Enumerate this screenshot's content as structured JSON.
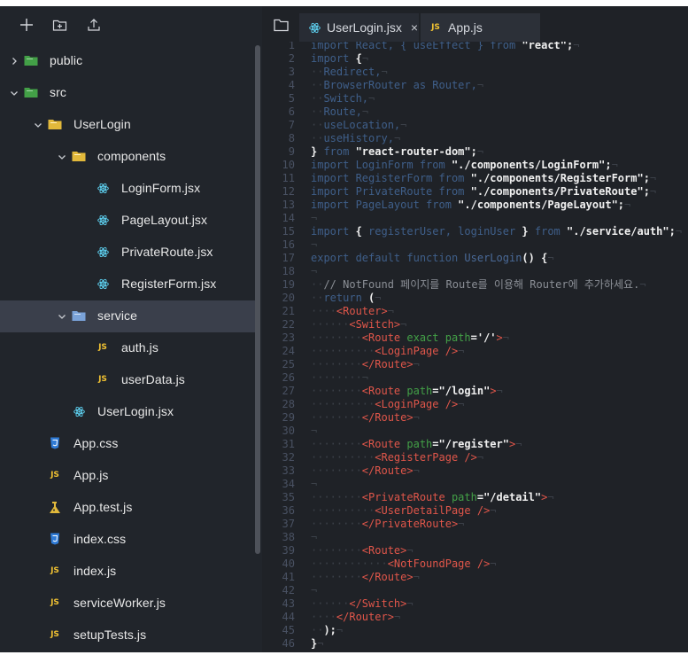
{
  "toolbar": {
    "new_file_icon": "plus-icon",
    "new_folder_icon": "new-folder-icon",
    "upload_icon": "upload-icon"
  },
  "tree": {
    "items": [
      {
        "label": "public",
        "level": 0,
        "chevron": "right",
        "icon": "folder-green"
      },
      {
        "label": "src",
        "level": 0,
        "chevron": "down",
        "icon": "folder-green"
      },
      {
        "label": "UserLogin",
        "level": 1,
        "chevron": "down",
        "icon": "folder-yellow"
      },
      {
        "label": "components",
        "level": 2,
        "chevron": "down",
        "icon": "folder-yellow"
      },
      {
        "label": "LoginForm.jsx",
        "level": 3,
        "icon": "react"
      },
      {
        "label": "PageLayout.jsx",
        "level": 3,
        "icon": "react"
      },
      {
        "label": "PrivateRoute.jsx",
        "level": 3,
        "icon": "react"
      },
      {
        "label": "RegisterForm.jsx",
        "level": 3,
        "icon": "react"
      },
      {
        "label": "service",
        "level": 2,
        "chevron": "down",
        "icon": "folder-blue",
        "active": true
      },
      {
        "label": "auth.js",
        "level": 3,
        "icon": "js"
      },
      {
        "label": "userData.js",
        "level": 3,
        "icon": "js"
      },
      {
        "label": "UserLogin.jsx",
        "level": 2,
        "icon": "react"
      },
      {
        "label": "App.css",
        "level": 1,
        "icon": "css"
      },
      {
        "label": "App.js",
        "level": 1,
        "icon": "js"
      },
      {
        "label": "App.test.js",
        "level": 1,
        "icon": "test"
      },
      {
        "label": "index.css",
        "level": 1,
        "icon": "css"
      },
      {
        "label": "index.js",
        "level": 1,
        "icon": "js"
      },
      {
        "label": "serviceWorker.js",
        "level": 1,
        "icon": "js"
      },
      {
        "label": "setupTests.js",
        "level": 1,
        "icon": "js"
      }
    ]
  },
  "editor": {
    "tabs": [
      {
        "label": "UserLogin.jsx",
        "icon": "react",
        "close": "×",
        "active": true
      },
      {
        "label": "App.js",
        "icon": "js",
        "active": false
      }
    ],
    "lines": [
      {
        "n": "1",
        "t": [
          [
            "k",
            "import React, { useEffect } from "
          ],
          [
            "w",
            "\"react\";"
          ]
        ]
      },
      {
        "n": "2",
        "t": [
          [
            "k",
            "import "
          ],
          [
            "w",
            "{"
          ]
        ]
      },
      {
        "n": "3",
        "t": [
          [
            "d",
            "··"
          ],
          [
            "k",
            "Redirect,"
          ]
        ]
      },
      {
        "n": "4",
        "t": [
          [
            "d",
            "··"
          ],
          [
            "k",
            "BrowserRouter as Router,"
          ]
        ]
      },
      {
        "n": "5",
        "t": [
          [
            "d",
            "··"
          ],
          [
            "k",
            "Switch,"
          ]
        ]
      },
      {
        "n": "6",
        "t": [
          [
            "d",
            "··"
          ],
          [
            "k",
            "Route,"
          ]
        ]
      },
      {
        "n": "7",
        "t": [
          [
            "d",
            "··"
          ],
          [
            "k",
            "useLocation,"
          ]
        ]
      },
      {
        "n": "8",
        "t": [
          [
            "d",
            "··"
          ],
          [
            "k",
            "useHistory,"
          ]
        ]
      },
      {
        "n": "9",
        "t": [
          [
            "w",
            "} "
          ],
          [
            "k",
            "from "
          ],
          [
            "w",
            "\"react-router-dom\";"
          ]
        ]
      },
      {
        "n": "10",
        "t": [
          [
            "k",
            "import LoginForm from "
          ],
          [
            "w",
            "\"./components/LoginForm\";"
          ]
        ]
      },
      {
        "n": "11",
        "t": [
          [
            "k",
            "import RegisterForm from "
          ],
          [
            "w",
            "\"./components/RegisterForm\";"
          ]
        ]
      },
      {
        "n": "12",
        "t": [
          [
            "k",
            "import PrivateRoute from "
          ],
          [
            "w",
            "\"./components/PrivateRoute\";"
          ]
        ]
      },
      {
        "n": "13",
        "t": [
          [
            "k",
            "import PageLayout from "
          ],
          [
            "w",
            "\"./components/PageLayout\";"
          ]
        ]
      },
      {
        "n": "14",
        "t": [
          [
            "d",
            ""
          ]
        ]
      },
      {
        "n": "15",
        "t": [
          [
            "k",
            "import "
          ],
          [
            "w",
            "{ "
          ],
          [
            "k",
            "registerUser, loginUser "
          ],
          [
            "w",
            "} "
          ],
          [
            "k",
            "from "
          ],
          [
            "w",
            "\"./service/auth\";"
          ]
        ]
      },
      {
        "n": "16",
        "t": [
          [
            "d",
            ""
          ]
        ]
      },
      {
        "n": "17",
        "t": [
          [
            "k",
            "export default function "
          ],
          [
            "f",
            "UserLogin"
          ],
          [
            "w",
            "() {"
          ]
        ]
      },
      {
        "n": "18",
        "t": [
          [
            "d",
            ""
          ]
        ]
      },
      {
        "n": "19",
        "t": [
          [
            "d",
            "··"
          ],
          [
            "c",
            "// NotFound 페이지를 Route를 이용해 Router에 추가하세요."
          ]
        ]
      },
      {
        "n": "20",
        "t": [
          [
            "d",
            "··"
          ],
          [
            "k",
            "return "
          ],
          [
            "w",
            "("
          ]
        ]
      },
      {
        "n": "21",
        "t": [
          [
            "d",
            "····"
          ],
          [
            "r",
            "<Router>"
          ]
        ]
      },
      {
        "n": "22",
        "t": [
          [
            "d",
            "······"
          ],
          [
            "r",
            "<Switch>"
          ]
        ]
      },
      {
        "n": "23",
        "t": [
          [
            "d",
            "········"
          ],
          [
            "r",
            "<Route "
          ],
          [
            "g",
            "exact path"
          ],
          [
            "w",
            "='/'"
          ],
          [
            "r",
            ">"
          ]
        ]
      },
      {
        "n": "24",
        "t": [
          [
            "d",
            "··········"
          ],
          [
            "r",
            "<LoginPage />"
          ]
        ]
      },
      {
        "n": "25",
        "t": [
          [
            "d",
            "········"
          ],
          [
            "r",
            "</Route>"
          ]
        ]
      },
      {
        "n": "26",
        "t": [
          [
            "d",
            "········"
          ]
        ]
      },
      {
        "n": "27",
        "t": [
          [
            "d",
            "········"
          ],
          [
            "r",
            "<Route "
          ],
          [
            "g",
            "path"
          ],
          [
            "w",
            "=\"/login\""
          ],
          [
            "r",
            ">"
          ]
        ]
      },
      {
        "n": "28",
        "t": [
          [
            "d",
            "··········"
          ],
          [
            "r",
            "<LoginPage />"
          ]
        ]
      },
      {
        "n": "29",
        "t": [
          [
            "d",
            "········"
          ],
          [
            "r",
            "</Route>"
          ]
        ]
      },
      {
        "n": "30",
        "t": [
          [
            "d",
            ""
          ]
        ]
      },
      {
        "n": "31",
        "t": [
          [
            "d",
            "········"
          ],
          [
            "r",
            "<Route "
          ],
          [
            "g",
            "path"
          ],
          [
            "w",
            "=\"/register\""
          ],
          [
            "r",
            ">"
          ]
        ]
      },
      {
        "n": "32",
        "t": [
          [
            "d",
            "··········"
          ],
          [
            "r",
            "<RegisterPage />"
          ]
        ]
      },
      {
        "n": "33",
        "t": [
          [
            "d",
            "········"
          ],
          [
            "r",
            "</Route>"
          ]
        ]
      },
      {
        "n": "34",
        "t": [
          [
            "d",
            ""
          ]
        ]
      },
      {
        "n": "35",
        "t": [
          [
            "d",
            "········"
          ],
          [
            "r",
            "<PrivateRoute "
          ],
          [
            "g",
            "path"
          ],
          [
            "w",
            "=\"/detail\""
          ],
          [
            "r",
            ">"
          ]
        ]
      },
      {
        "n": "36",
        "t": [
          [
            "d",
            "··········"
          ],
          [
            "r",
            "<UserDetailPage />"
          ]
        ]
      },
      {
        "n": "37",
        "t": [
          [
            "d",
            "········"
          ],
          [
            "r",
            "</PrivateRoute>"
          ]
        ]
      },
      {
        "n": "38",
        "t": [
          [
            "d",
            ""
          ]
        ]
      },
      {
        "n": "39",
        "t": [
          [
            "d",
            "········"
          ],
          [
            "r",
            "<Route>"
          ]
        ]
      },
      {
        "n": "40",
        "t": [
          [
            "d",
            "············"
          ],
          [
            "r",
            "<NotFoundPage />"
          ]
        ]
      },
      {
        "n": "41",
        "t": [
          [
            "d",
            "········"
          ],
          [
            "r",
            "</Route>"
          ]
        ]
      },
      {
        "n": "42",
        "t": [
          [
            "d",
            ""
          ]
        ]
      },
      {
        "n": "43",
        "t": [
          [
            "d",
            "······"
          ],
          [
            "r",
            "</Switch>"
          ]
        ]
      },
      {
        "n": "44",
        "t": [
          [
            "d",
            "····"
          ],
          [
            "r",
            "</Router>"
          ]
        ]
      },
      {
        "n": "45",
        "t": [
          [
            "d",
            "··"
          ],
          [
            "w",
            ");"
          ]
        ]
      },
      {
        "n": "46",
        "t": [
          [
            "w",
            "}"
          ]
        ]
      }
    ]
  },
  "colors": {
    "sidebar_bg": "#21252b",
    "editor_bg": "#1f2227",
    "active_row": "#3a3f4b",
    "react": "#61dafb",
    "js": "#f1c232",
    "css": "#2f7bd6",
    "folder_green": "#4caf50",
    "folder_yellow": "#e2b93b",
    "folder_blue": "#7aa2d8"
  }
}
